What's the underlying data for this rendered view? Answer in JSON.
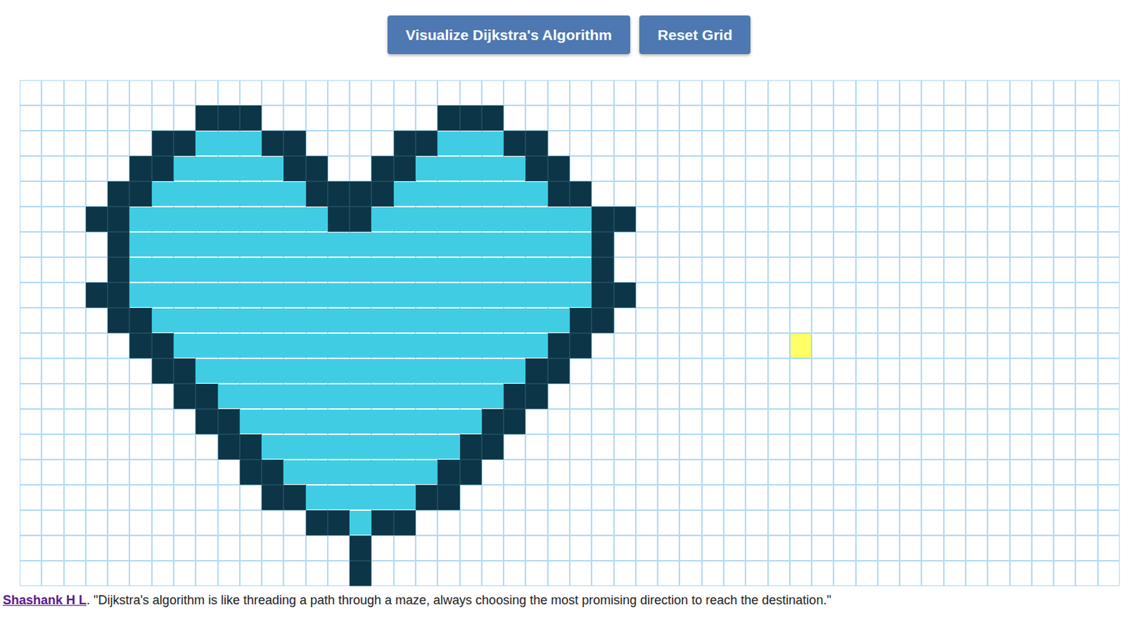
{
  "buttons": [
    {
      "label": "Visualize Dijkstra's Algorithm"
    },
    {
      "label": "Reset Grid"
    }
  ],
  "grid": {
    "columns": 50,
    "end_node": {
      "row": 10,
      "col": 35
    },
    "rows": [
      {
        "wall": [],
        "visited": []
      },
      {
        "wall": [
          [
            8,
            10
          ],
          [
            19,
            21
          ]
        ],
        "visited": []
      },
      {
        "wall": [
          [
            6,
            7
          ],
          [
            11,
            12
          ],
          [
            17,
            18
          ],
          [
            22,
            23
          ]
        ],
        "visited": [
          [
            8,
            10
          ],
          [
            19,
            21
          ]
        ]
      },
      {
        "wall": [
          [
            5,
            6
          ],
          [
            12,
            13
          ],
          [
            16,
            17
          ],
          [
            23,
            24
          ]
        ],
        "visited": [
          [
            7,
            11
          ],
          [
            18,
            22
          ]
        ]
      },
      {
        "wall": [
          [
            4,
            5
          ],
          [
            13,
            16
          ],
          [
            24,
            25
          ]
        ],
        "visited": [
          [
            6,
            12
          ],
          [
            17,
            23
          ]
        ]
      },
      {
        "wall": [
          [
            3,
            4
          ],
          [
            14,
            15
          ],
          [
            26,
            27
          ]
        ],
        "visited": [
          [
            5,
            13
          ],
          [
            16,
            25
          ]
        ]
      },
      {
        "wall": [
          [
            4,
            4
          ],
          [
            26,
            26
          ]
        ],
        "visited": [
          [
            5,
            25
          ]
        ]
      },
      {
        "wall": [
          [
            4,
            4
          ],
          [
            26,
            26
          ]
        ],
        "visited": [
          [
            5,
            25
          ]
        ]
      },
      {
        "wall": [
          [
            3,
            4
          ],
          [
            26,
            27
          ]
        ],
        "visited": [
          [
            5,
            25
          ]
        ]
      },
      {
        "wall": [
          [
            4,
            5
          ],
          [
            25,
            26
          ]
        ],
        "visited": [
          [
            6,
            24
          ]
        ]
      },
      {
        "wall": [
          [
            5,
            6
          ],
          [
            24,
            25
          ]
        ],
        "visited": [
          [
            7,
            23
          ]
        ]
      },
      {
        "wall": [
          [
            6,
            7
          ],
          [
            23,
            24
          ]
        ],
        "visited": [
          [
            8,
            22
          ]
        ]
      },
      {
        "wall": [
          [
            7,
            8
          ],
          [
            22,
            23
          ]
        ],
        "visited": [
          [
            9,
            21
          ]
        ]
      },
      {
        "wall": [
          [
            8,
            9
          ],
          [
            21,
            22
          ]
        ],
        "visited": [
          [
            10,
            20
          ]
        ]
      },
      {
        "wall": [
          [
            9,
            10
          ],
          [
            20,
            21
          ]
        ],
        "visited": [
          [
            11,
            19
          ]
        ]
      },
      {
        "wall": [
          [
            10,
            11
          ],
          [
            19,
            20
          ]
        ],
        "visited": [
          [
            12,
            18
          ]
        ]
      },
      {
        "wall": [
          [
            11,
            12
          ],
          [
            18,
            19
          ]
        ],
        "visited": [
          [
            13,
            17
          ]
        ]
      },
      {
        "wall": [
          [
            13,
            14
          ],
          [
            16,
            17
          ]
        ],
        "visited": [
          [
            15,
            15
          ]
        ]
      },
      {
        "wall": [
          [
            15,
            15
          ]
        ],
        "visited": []
      },
      {
        "wall": [
          [
            15,
            15
          ]
        ],
        "visited": []
      }
    ]
  },
  "footer": {
    "author": "Shashank H L",
    "text": ". \"Dijkstra's algorithm is like threading a path through a maze, always choosing the most promising direction to reach the destination.\""
  }
}
